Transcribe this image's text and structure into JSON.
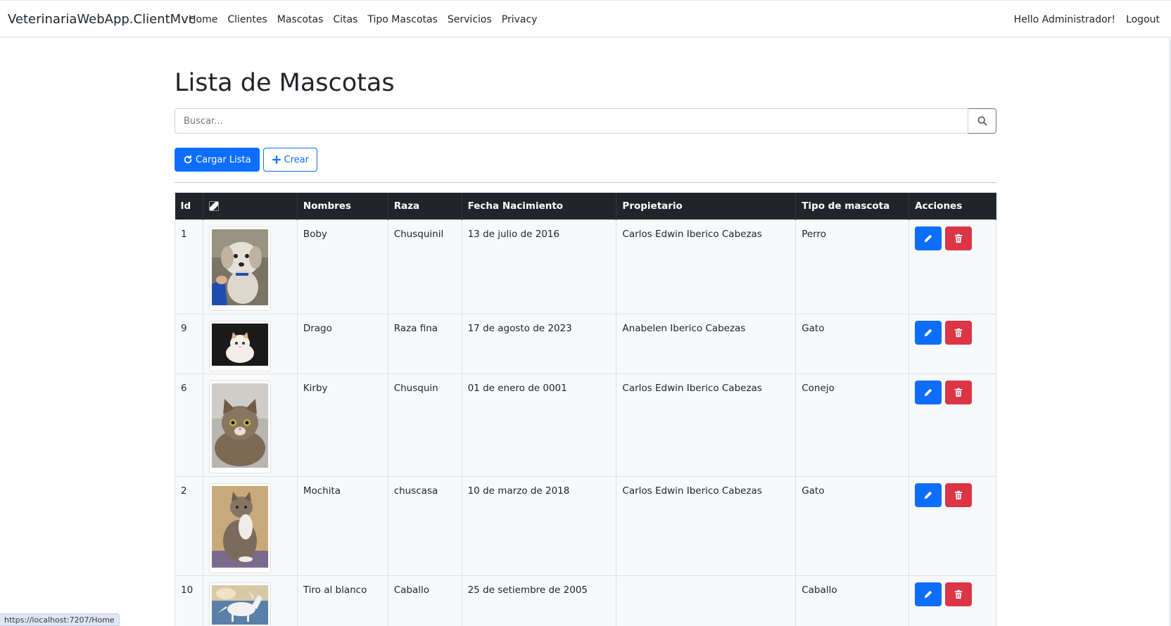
{
  "navbar": {
    "brand": "VeterinariaWebApp.ClientMvc",
    "links": [
      "Home",
      "Clientes",
      "Mascotas",
      "Citas",
      "Tipo Mascotas",
      "Servicios",
      "Privacy"
    ],
    "greeting": "Hello Administrador!",
    "logout": "Logout"
  },
  "page": {
    "title": "Lista de Mascotas",
    "search_placeholder": "Buscar...",
    "load_button": "Cargar Lista",
    "create_button": "Crear"
  },
  "table": {
    "headers": [
      "Id",
      "image-icon",
      "Nombres",
      "Raza",
      "Fecha Nacimiento",
      "Propietario",
      "Tipo de mascota",
      "Acciones"
    ],
    "rows": [
      {
        "id": "1",
        "photo": "dog-photo",
        "nombre": "Boby",
        "raza": "Chusquinil",
        "fecha": "13 de julio de 2016",
        "propietario": "Carlos Edwin Iberico Cabezas",
        "tipo": "Perro"
      },
      {
        "id": "9",
        "photo": "white-kitten-photo",
        "nombre": "Drago",
        "raza": "Raza fina",
        "fecha": "17 de agosto de 2023",
        "propietario": "Anabelen Iberico Cabezas",
        "tipo": "Gato"
      },
      {
        "id": "6",
        "photo": "tabby-cat-photo",
        "nombre": "Kirby",
        "raza": "Chusquin",
        "fecha": "01 de enero de 0001",
        "propietario": "Carlos Edwin Iberico Cabezas",
        "tipo": "Conejo"
      },
      {
        "id": "2",
        "photo": "sitting-cat-photo",
        "nombre": "Mochita",
        "raza": "chuscasa",
        "fecha": "10 de marzo de 2018",
        "propietario": "Carlos Edwin Iberico Cabezas",
        "tipo": "Gato"
      },
      {
        "id": "10",
        "photo": "white-horse-photo",
        "nombre": "Tiro al blanco",
        "raza": "Caballo",
        "fecha": "25 de setiembre de 2005",
        "propietario": "",
        "tipo": "Caballo"
      }
    ]
  },
  "status_bar": {
    "url": "https://localhost:7207/Home"
  },
  "colors": {
    "primary": "#0d6efd",
    "danger": "#dc3545",
    "header_bg": "#212529",
    "row_bg": "#f8f9fa"
  }
}
